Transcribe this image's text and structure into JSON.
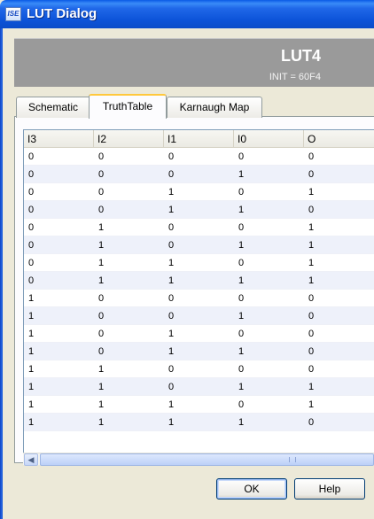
{
  "window": {
    "title": "LUT Dialog",
    "icon_text": "ISE"
  },
  "header": {
    "name": "LUT4",
    "init": "INIT = 60F4",
    "band_color": "#9a9a9a"
  },
  "tabs": [
    {
      "label": "Schematic",
      "active": false
    },
    {
      "label": "TruthTable",
      "active": true
    },
    {
      "label": "Karnaugh Map",
      "active": false
    }
  ],
  "table": {
    "columns": [
      "I3",
      "I2",
      "I1",
      "I0",
      "O"
    ],
    "rows": [
      [
        "0",
        "0",
        "0",
        "0",
        "0"
      ],
      [
        "0",
        "0",
        "0",
        "1",
        "0"
      ],
      [
        "0",
        "0",
        "1",
        "0",
        "1"
      ],
      [
        "0",
        "0",
        "1",
        "1",
        "0"
      ],
      [
        "0",
        "1",
        "0",
        "0",
        "1"
      ],
      [
        "0",
        "1",
        "0",
        "1",
        "1"
      ],
      [
        "0",
        "1",
        "1",
        "0",
        "1"
      ],
      [
        "0",
        "1",
        "1",
        "1",
        "1"
      ],
      [
        "1",
        "0",
        "0",
        "0",
        "0"
      ],
      [
        "1",
        "0",
        "0",
        "1",
        "0"
      ],
      [
        "1",
        "0",
        "1",
        "0",
        "0"
      ],
      [
        "1",
        "0",
        "1",
        "1",
        "0"
      ],
      [
        "1",
        "1",
        "0",
        "0",
        "0"
      ],
      [
        "1",
        "1",
        "0",
        "1",
        "1"
      ],
      [
        "1",
        "1",
        "1",
        "0",
        "1"
      ],
      [
        "1",
        "1",
        "1",
        "1",
        "0"
      ]
    ]
  },
  "buttons": {
    "ok": "OK",
    "help": "Help"
  },
  "colors": {
    "titlebar": "#0d54d9",
    "tab_highlight": "#ffc83c",
    "row_alt": "#eef1fa"
  }
}
